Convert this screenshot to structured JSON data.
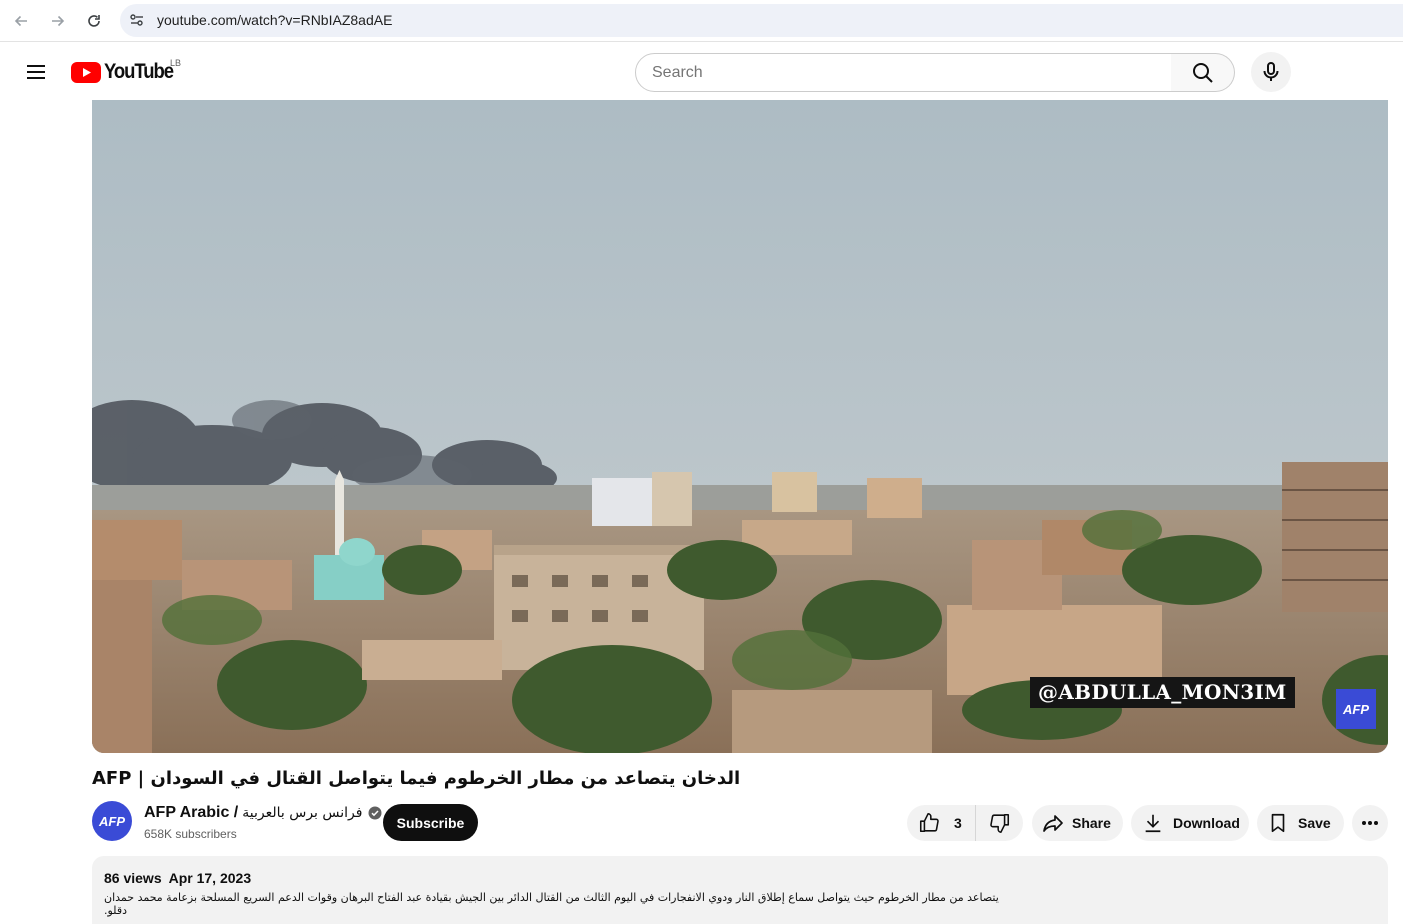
{
  "browser": {
    "url": "youtube.com/watch?v=RNbIAZ8adAE"
  },
  "header": {
    "logo_text": "YouTube",
    "region": "LB",
    "search_placeholder": "Search"
  },
  "video": {
    "overlay_handle": "@ABDULLA_MON3IM",
    "corner_logo": "AFP",
    "title": "AFP | الدخان يتصاعد من مطار الخرطوم فيما يتواصل القتال في السودان"
  },
  "channel": {
    "avatar_text": "AFP",
    "name": "AFP Arabic /",
    "name_ar": "فرانس برس بالعربية",
    "subscribers": "658K subscribers",
    "subscribe_label": "Subscribe"
  },
  "actions": {
    "like_count": "3",
    "share_label": "Share",
    "download_label": "Download",
    "save_label": "Save"
  },
  "description": {
    "views": "86 views",
    "date": "Apr 17, 2023",
    "text": "يتصاعد من مطار الخرطوم حيث يتواصل سماع إطلاق النار ودوي الانفجارات في اليوم الثالث من القتال الدائر بين الجيش بقيادة عبد الفتاح البرهان وقوات الدعم السريع المسلحة بزعامة محمد حمدان دقلو."
  }
}
